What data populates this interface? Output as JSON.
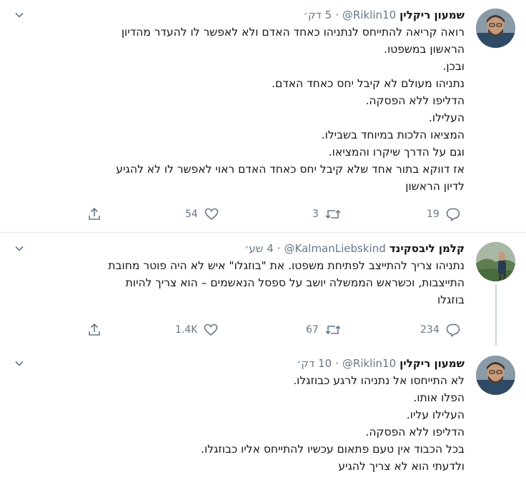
{
  "colors": {
    "text": "#14171a",
    "secondary": "#657786",
    "divider": "#e1e8ed",
    "thread_line": "#ccd6dd"
  },
  "tweets": [
    {
      "name": "שמעון ריקלין",
      "handle": "@Riklin10",
      "time": "5 דק׳",
      "text_lines": [
        "רואה קריאה להתייחס לנתניהו כאחד האדם ולא לאפשר לו להעדר מהדיון",
        "הראשון במשפטו.",
        "ובכן.",
        "נתניהו מעולם לא קיבל יחס כאחד האדם.",
        "הדליפו ללא הפסקה.",
        "העלילו.",
        "המציאו הלכות במיוחד בשבילו.",
        "וגם על הדרך שיקרו והמציאו.",
        "אז דווקא בתור אחד שלא קיבל יחס כאחד האדם ראוי לאפשר לו לא להגיע",
        "לדיון הראשון"
      ],
      "replies": "19",
      "retweets": "3",
      "likes": "54"
    },
    {
      "name": "קלמן ליבסקינד",
      "handle": "@KalmanLiebskind",
      "time": "4 שע׳",
      "text_lines": [
        "נתניהו צריך להתייצב לפתיחת משפטו. את \"בוזגלו\" איש לא היה פוטר מחובת",
        "התייצבות, וכשראש הממשלה יושב על ספסל הנאשמים – הוא צריך להיות",
        "בוזגלו"
      ],
      "replies": "234",
      "retweets": "67",
      "likes": "1.4K"
    },
    {
      "name": "שמעון ריקלין",
      "handle": "@Riklin10",
      "time": "10 דק׳",
      "text_lines": [
        "לא התייחסו אל נתניהו לרגע כבוזגלו.",
        "הפלו אותו.",
        "העלילו עליו.",
        "הדליפו ללא הפסקה.",
        "בכל הכבוד אין טעם פתאום עכשיו להתייחס אליו כבוזגלו.",
        "ולדעתי הוא לא צריך להגיע"
      ]
    }
  ]
}
